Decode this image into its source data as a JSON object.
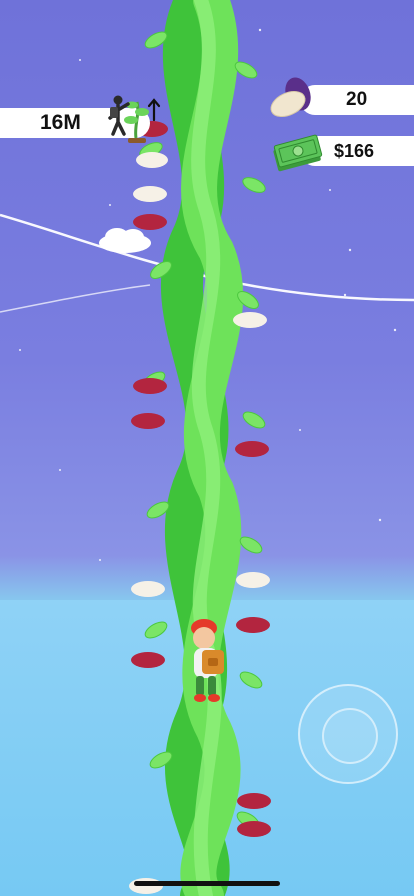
{
  "hud": {
    "height_label": "16M",
    "beans_count": "20",
    "cash": "$166"
  },
  "icons": {
    "climb": "climber-plant-arrow-icon",
    "beans": "beans-icon",
    "cash": "money-stack-icon"
  },
  "colors": {
    "sky": "#7a7ee0",
    "sea": "#7fd0f5",
    "stalk": "#5fd84c",
    "red_bean": "#b3253f",
    "white_bean": "#f6f1e7"
  }
}
